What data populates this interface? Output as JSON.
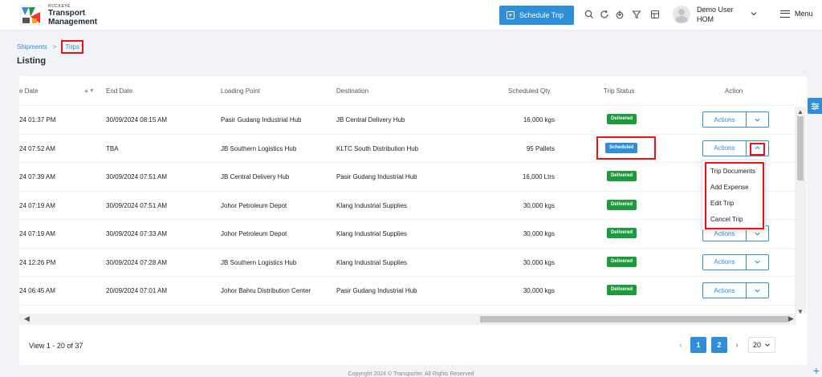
{
  "header": {
    "brand_small": "ROCKEYE",
    "brand_line1": "Transport",
    "brand_line2": "Management",
    "schedule_button": "Schedule Trip",
    "user_name": "Demo User",
    "user_role": "HOM",
    "menu_label": "Menu"
  },
  "breadcrumb": {
    "parent": "Shipments",
    "separator": ">",
    "current": "Trips"
  },
  "page_title": "Listing",
  "table": {
    "columns": {
      "start_date": "e Date",
      "end_date": "End Date",
      "loading_point": "Loading Point",
      "destination": "Destination",
      "scheduled_qty": "Scheduled Qty",
      "trip_status": "Trip Status",
      "action": "Action"
    },
    "action_label": "Actions",
    "rows": [
      {
        "start": "24 01:37 PM",
        "end": "30/09/2024 08:15 AM",
        "loading": "Pasir Gudang Industrial Hub",
        "destination": "JB Central Delivery Hub",
        "qty": "16,000 kgs",
        "status": "Delivered"
      },
      {
        "start": "24 07:52 AM",
        "end": "TBA",
        "loading": "JB Southern Logistics Hub",
        "destination": "KLTC South Distribution Hub",
        "qty": "95 Pallets",
        "status": "Scheduled"
      },
      {
        "start": "24 07:39 AM",
        "end": "30/09/2024 07:51 AM",
        "loading": "JB Central Delivery Hub",
        "destination": "Pasir Gudang Industrial Hub",
        "qty": "16,000 Ltrs",
        "status": "Delivered"
      },
      {
        "start": "24 07:19 AM",
        "end": "30/09/2024 07:51 AM",
        "loading": "Johor Petroleum Depot",
        "destination": "Klang Industrial Supplies",
        "qty": "30,000 kgs",
        "status": "Delivered"
      },
      {
        "start": "24 07:19 AM",
        "end": "30/09/2024 07:33 AM",
        "loading": "Johor Petroleum Depot",
        "destination": "Klang Industrial Supplies",
        "qty": "30,000 kgs",
        "status": "Delivered"
      },
      {
        "start": "24 12:26 PM",
        "end": "30/09/2024 07:28 AM",
        "loading": "JB Southern Logistics Hub",
        "destination": "Klang Industrial Supplies",
        "qty": "30,000 kgs",
        "status": "Delivered"
      },
      {
        "start": "24 06:45 AM",
        "end": "20/09/2024 07:01 AM",
        "loading": "Johor Bahru Distribution Center",
        "destination": "Pasir Gudang Industrial Hub",
        "qty": "30,000 kgs",
        "status": "Delivered"
      }
    ]
  },
  "dropdown": {
    "items": [
      "Trip Documents",
      "Add Expense",
      "Edit Trip",
      "Cancel Trip"
    ]
  },
  "pagination": {
    "view_text": "View 1 - 20 of 37",
    "pages": [
      "1",
      "2"
    ],
    "page_size": "20"
  },
  "footer": {
    "copyright": "Copyright 2024 © Transporter. All Rights Reserved"
  },
  "colors": {
    "accent": "#2e8fd8",
    "delivered": "#1e9a3c",
    "highlight": "#ee1111"
  },
  "icons": [
    "search-icon",
    "refresh-icon",
    "download-icon",
    "filter-icon",
    "layout-icon",
    "chevron-down-icon",
    "menu-icon",
    "sort-icon",
    "filter-settings-icon",
    "plus-icon"
  ]
}
